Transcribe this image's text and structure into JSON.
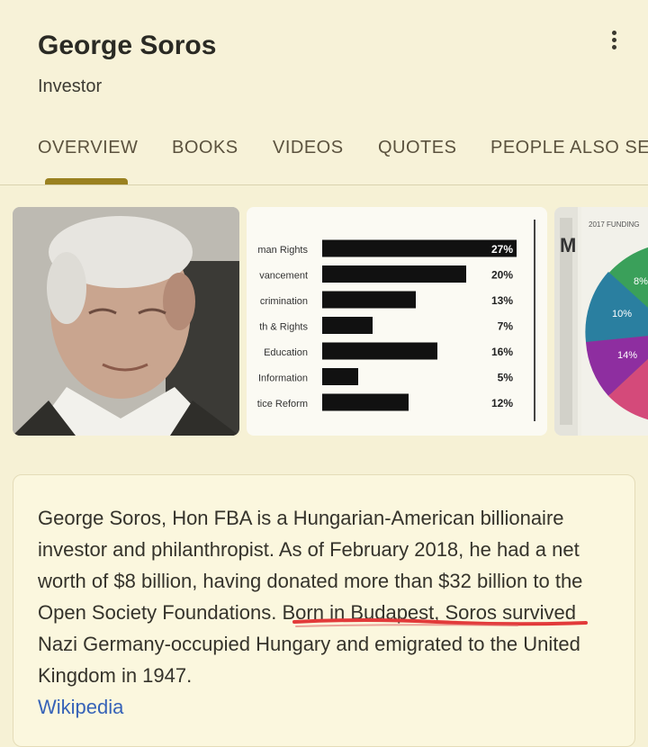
{
  "header": {
    "title": "George Soros",
    "subtitle": "Investor"
  },
  "tabs": [
    {
      "label": "OVERVIEW",
      "selected": true
    },
    {
      "label": "BOOKS"
    },
    {
      "label": "VIDEOS"
    },
    {
      "label": "QUOTES"
    },
    {
      "label": "PEOPLE ALSO SEA"
    }
  ],
  "images": {
    "chart": {
      "rows": [
        {
          "label": "man Rights",
          "value": "27%"
        },
        {
          "label": "vancement",
          "value": "20%"
        },
        {
          "label": "crimination",
          "value": "13%"
        },
        {
          "label": "th & Rights",
          "value": "7%"
        },
        {
          "label": "Education",
          "value": "16%"
        },
        {
          "label": "Information",
          "value": "5%"
        },
        {
          "label": "tice Reform",
          "value": "12%"
        }
      ]
    },
    "pie": {
      "title": "2017 FUNDING",
      "labels": [
        "8%",
        "10%",
        "14%"
      ]
    }
  },
  "about": {
    "text_before": "George Soros, Hon FBA is a Hungarian-American billionaire investor and philanthropist. As of February 2018, he had a net worth of $8 billion, having donated more than $32 billion to the ",
    "text_underlined": "Open Society Foundations.",
    "text_after": " Born in Budapest, Soros survived Nazi Germany-occupied Hungary and emigrated to the United Kingdom in 1947.",
    "source": "Wikipedia"
  },
  "colors": {
    "background": "#f6f1d5",
    "tab_indicator": "#9a8120",
    "link": "#3763b8",
    "annotation": "#e23a3a"
  }
}
